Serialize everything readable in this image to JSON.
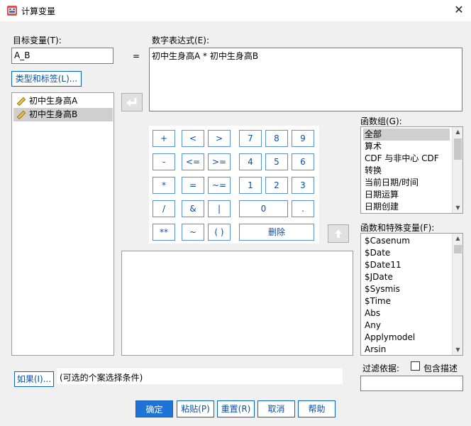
{
  "window": {
    "title": "计算变量",
    "close_glyph": "✕"
  },
  "target": {
    "label": "目标变量(T):",
    "value": "A_B",
    "type_label_button": "类型和标签(L)..."
  },
  "equals": "=",
  "expression": {
    "label": "数字表达式(E):",
    "value": "初中生身高A * 初中生身高B"
  },
  "variables": [
    {
      "name": "初中生身高A",
      "selected": false
    },
    {
      "name": "初中生身高B",
      "selected": true
    }
  ],
  "keypad": {
    "row1": [
      "+",
      "<",
      ">",
      "7",
      "8",
      "9"
    ],
    "row2": [
      "-",
      "<=",
      ">=",
      "4",
      "5",
      "6"
    ],
    "row3": [
      "*",
      "=",
      "~=",
      "1",
      "2",
      "3"
    ],
    "row4": [
      "/",
      "&",
      "|",
      "0",
      "."
    ],
    "row5": [
      "**",
      "~",
      "( )",
      "删除"
    ]
  },
  "function_group": {
    "label": "函数组(G):",
    "items": [
      "全部",
      "算术",
      "CDF 与非中心 CDF",
      "转换",
      "当前日期/时间",
      "日期运算",
      "日期创建"
    ],
    "selected_index": 0
  },
  "functions": {
    "label": "函数和特殊变量(F):",
    "items": [
      "$Casenum",
      "$Date",
      "$Date11",
      "$JDate",
      "$Sysmis",
      "$Time",
      "Abs",
      "Any",
      "Applymodel",
      "Arsin"
    ]
  },
  "condition": {
    "if_button": "如果(I)...",
    "text": "(可选的个案选择条件)"
  },
  "filter": {
    "label": "过滤依据:",
    "checkbox_label": "包含描述",
    "checked": false,
    "value": ""
  },
  "footer": {
    "ok": "确定",
    "paste": "粘贴(P)",
    "reset": "重置(R)",
    "cancel": "取消",
    "help": "帮助"
  },
  "colors": {
    "accent": "#0a64c6",
    "primary_button": "#1e74d6",
    "selection": "#cfcfcf"
  }
}
